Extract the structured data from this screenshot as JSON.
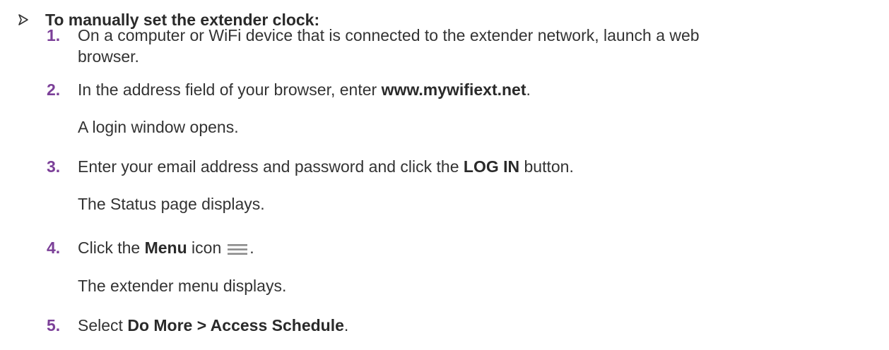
{
  "heading": "To manually set the extender clock:",
  "steps": [
    {
      "num": "1.",
      "line1": "On a computer or WiFi device that is connected to the extender network, launch a web",
      "line2": "browser."
    },
    {
      "num": "2.",
      "pre": "In the address field of your browser, enter ",
      "bold": "www.mywifiext.net",
      "post": "."
    },
    {
      "num": "3.",
      "pre": "Enter your email address and password and click the ",
      "bold": "LOG IN",
      "post": " button."
    },
    {
      "num": "4.",
      "pre": "Click the ",
      "bold": "Menu",
      "post": " icon",
      "tail": ".",
      "icon": "menu-icon"
    },
    {
      "num": "5.",
      "pre": "Select ",
      "bold": "Do More > Access Schedule",
      "post": "."
    }
  ],
  "results": {
    "after_step2": "A login window opens.",
    "after_step3": "The Status page displays.",
    "after_step4": "The extender menu displays."
  },
  "colors": {
    "step_number": "#7b3f98",
    "text": "#333333",
    "icon": "#8a8a8a"
  }
}
